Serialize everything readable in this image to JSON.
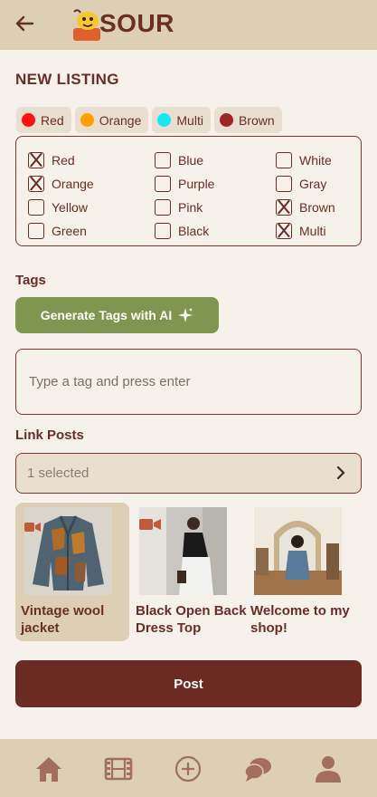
{
  "header": {
    "logo_text": "SOUR",
    "icons": {
      "back": "arrow-left-icon",
      "mascot": "lemon-mascot-icon"
    }
  },
  "listing": {
    "title": "NEW LISTING",
    "selected_chips": [
      {
        "label": "Red",
        "color": "#ff1010"
      },
      {
        "label": "Orange",
        "color": "#ffa000"
      },
      {
        "label": "Multi",
        "color": "#18e6f0"
      },
      {
        "label": "Brown",
        "color": "#a02626"
      }
    ],
    "colors": [
      {
        "label": "Red",
        "checked": true
      },
      {
        "label": "Blue",
        "checked": false
      },
      {
        "label": "White",
        "checked": false
      },
      {
        "label": "Orange",
        "checked": true
      },
      {
        "label": "Purple",
        "checked": false
      },
      {
        "label": "Gray",
        "checked": false
      },
      {
        "label": "Yellow",
        "checked": false
      },
      {
        "label": "Pink",
        "checked": false
      },
      {
        "label": "Brown",
        "checked": true
      },
      {
        "label": "Green",
        "checked": false
      },
      {
        "label": "Black",
        "checked": false
      },
      {
        "label": "Multi",
        "checked": true
      }
    ]
  },
  "tags": {
    "label": "Tags",
    "ai_button": "Generate Tags with AI",
    "input_placeholder": "Type a tag and press enter"
  },
  "link_posts": {
    "label": "Link Posts",
    "selected_text": "1 selected",
    "posts": [
      {
        "title": "Vintage wool jacket",
        "selected": true
      },
      {
        "title": "Black Open Back Dress Top",
        "selected": false
      },
      {
        "title": "Welcome to my shop!",
        "selected": false
      }
    ]
  },
  "post_button": "Post",
  "tabbar": [
    "home-icon",
    "film-icon",
    "plus-circle-icon",
    "chat-icon",
    "profile-icon"
  ],
  "theme": {
    "primary": "#6b2e26",
    "accent": "#7f9550",
    "bar": "#dccfb4",
    "bg": "#f6f1ea"
  }
}
